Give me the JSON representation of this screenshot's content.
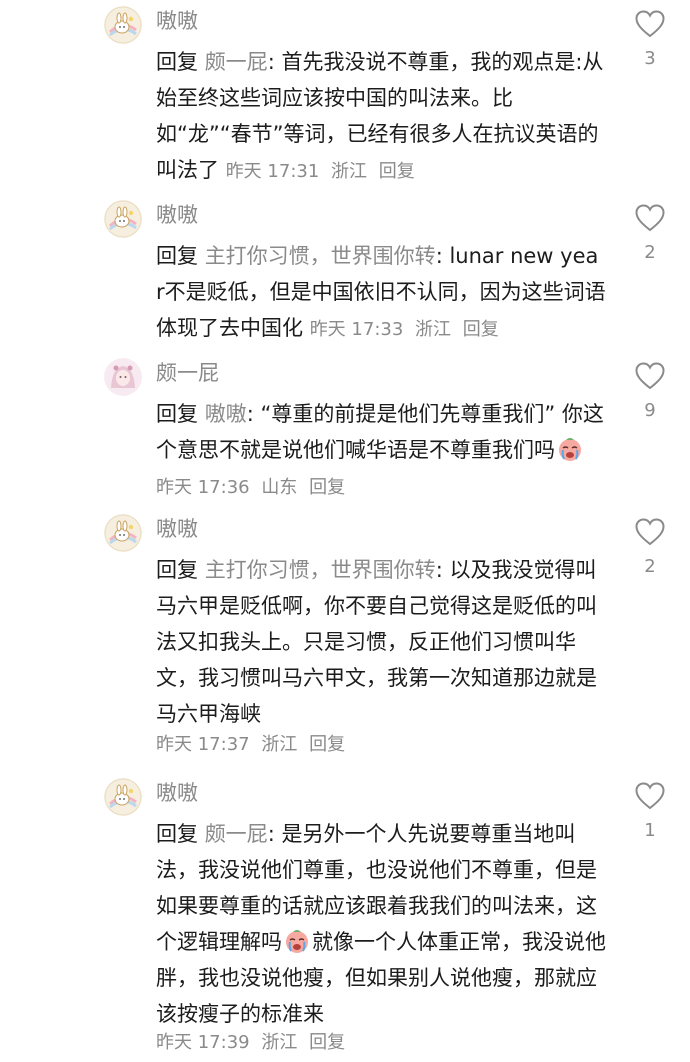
{
  "comments": [
    {
      "username": "嗷嗷",
      "reply_label": "回复",
      "reply_target": "颇一屁",
      "text": ": 首先我没说不尊重，我的观点是:从始至终这些词应该按中国的叫法来。比如“龙”“春节”等词，已经有很多人在抗议英语的叫法了",
      "time": "昨天 17:31",
      "location": "浙江",
      "reply_action": "回复",
      "likes": "3"
    },
    {
      "username": "嗷嗷",
      "reply_label": "回复",
      "reply_target": "主打你习惯，世界围你转",
      "text": ": lunar new year不是贬低，但是中国依旧不认同，因为这些词语体现了去中国化",
      "time": "昨天 17:33",
      "location": "浙江",
      "reply_action": "回复",
      "likes": "2"
    },
    {
      "username": "颇一屁",
      "reply_label": "回复",
      "reply_target": "嗷嗷",
      "text": ": “尊重的前提是他们先尊重我们” 你这个意思不就是说他们喊华语是不尊重我们吗",
      "time": "昨天 17:36",
      "location": "山东",
      "reply_action": "回复",
      "likes": "9"
    },
    {
      "username": "嗷嗷",
      "reply_label": "回复",
      "reply_target": "主打你习惯，世界围你转",
      "text": ": 以及我没觉得叫马六甲是贬低啊，你不要自己觉得这是贬低的叫法又扣我头上。只是习惯，反正他们习惯叫华文，我习惯叫马六甲文，我第一次知道那边就是马六甲海峡",
      "time": "昨天 17:37",
      "location": "浙江",
      "reply_action": "回复",
      "likes": "2"
    },
    {
      "username": "嗷嗷",
      "reply_label": "回复",
      "reply_target": "颇一屁",
      "text_a": ": 是另外一个人先说要尊重当地叫法，我没说他们尊重，也没说他们不尊重，但是如果要尊重的话就应该跟着我我们的叫法来，这个逻辑理解吗",
      "text_b": "就像一个人体重正常，我没说他胖，我也没说他瘦，但如果别人说他瘦，那就应该按瘦子的标准来",
      "time": "昨天 17:39",
      "location": "浙江",
      "reply_action": "回复",
      "likes": "1"
    }
  ],
  "icons": {
    "heart": "heart-outline-icon",
    "emoji": "crying-face-emoji-icon"
  },
  "colors": {
    "text": "#1c1c1c",
    "muted": "#8a8a8a"
  }
}
